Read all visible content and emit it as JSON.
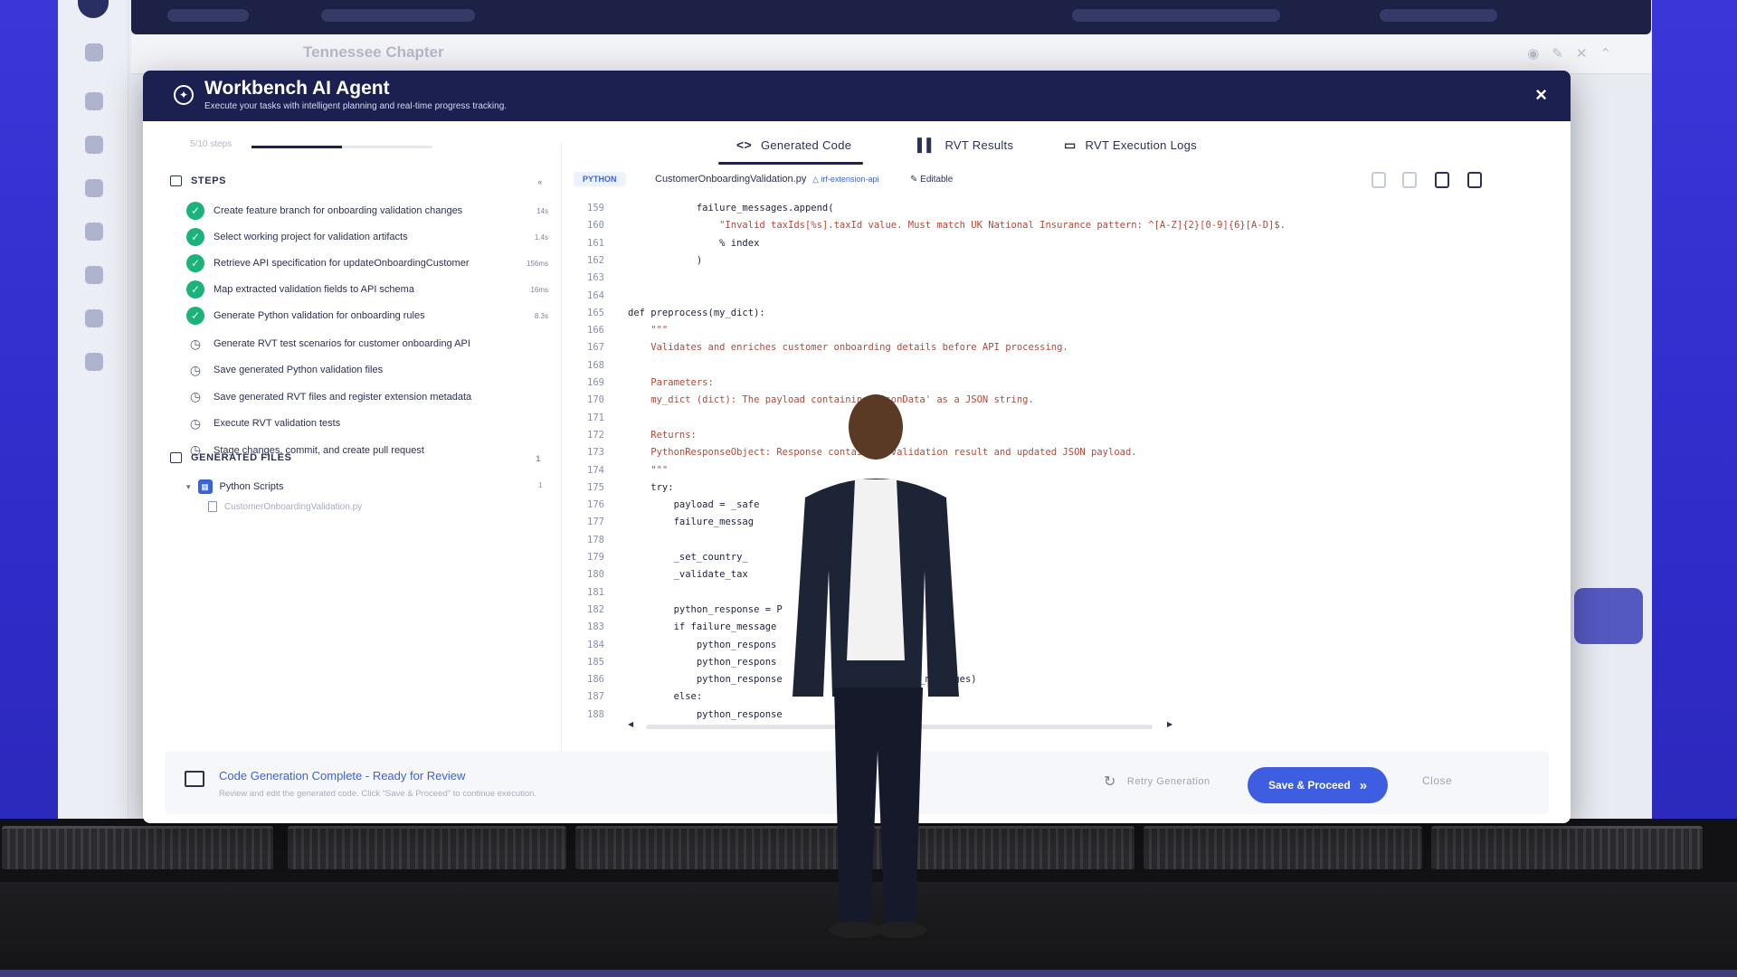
{
  "modal": {
    "title": "Workbench AI Agent",
    "subtitle": "Execute your tasks with intelligent planning and real-time progress tracking.",
    "close_glyph": "×"
  },
  "progress": {
    "text": "5/10 steps",
    "fraction": 0.5
  },
  "steps_section": {
    "label": "STEPS",
    "collapse_glyph": "«"
  },
  "steps": [
    {
      "label": "Create feature branch for onboarding validation changes",
      "status": "done",
      "duration": "14s"
    },
    {
      "label": "Select working project for validation artifacts",
      "status": "done",
      "duration": "1.4s"
    },
    {
      "label": "Retrieve API specification for updateOnboardingCustomer",
      "status": "done",
      "duration": "156ms"
    },
    {
      "label": "Map extracted validation fields to API schema",
      "status": "done",
      "duration": "16ms"
    },
    {
      "label": "Generate Python validation for onboarding rules",
      "status": "done",
      "duration": "8.3s"
    },
    {
      "label": "Generate RVT test scenarios for customer onboarding API",
      "status": "pending",
      "duration": ""
    },
    {
      "label": "Save generated Python validation files",
      "status": "pending",
      "duration": ""
    },
    {
      "label": "Save generated RVT files and register extension metadata",
      "status": "pending",
      "duration": ""
    },
    {
      "label": "Execute RVT validation tests",
      "status": "pending",
      "duration": ""
    },
    {
      "label": "Stage changes, commit, and create pull request",
      "status": "pending",
      "duration": ""
    }
  ],
  "generated_files": {
    "label": "GENERATED FILES",
    "count": "1",
    "folder": {
      "label": "Python Scripts",
      "count": "1"
    },
    "file": "CustomerOnboardingValidation.py"
  },
  "tabs": [
    {
      "icon": "<>",
      "label": "Generated Code",
      "active": true
    },
    {
      "icon": "▌▌",
      "label": "RVT Results",
      "active": false
    },
    {
      "icon": "▭",
      "label": "RVT Execution Logs",
      "active": false
    }
  ],
  "file_toolbar": {
    "language": "PYTHON",
    "file_name": "CustomerOnboardingValidation.py",
    "repo": "△ irf-extension-api",
    "editable": "✎ Editable"
  },
  "code": [
    {
      "ln": "159",
      "text": "            failure_messages.append("
    },
    {
      "ln": "160",
      "text": "                \"Invalid taxIds[%s].taxId value. Must match UK National Insurance pattern: ^[A-Z]{2}[0-9]{6}[A-D]$."
    },
    {
      "ln": "161",
      "text": "                % index"
    },
    {
      "ln": "162",
      "text": "            )"
    },
    {
      "ln": "163",
      "text": ""
    },
    {
      "ln": "164",
      "text": ""
    },
    {
      "ln": "165",
      "text": "def preprocess(my_dict):"
    },
    {
      "ln": "166",
      "text": "    \"\"\""
    },
    {
      "ln": "167",
      "text": "    Validates and enriches customer onboarding details before API processing."
    },
    {
      "ln": "168",
      "text": ""
    },
    {
      "ln": "169",
      "text": "    Parameters:"
    },
    {
      "ln": "170",
      "text": "    my_dict (dict): The payload containing 'jsonData' as a JSON string."
    },
    {
      "ln": "171",
      "text": ""
    },
    {
      "ln": "172",
      "text": "    Returns:"
    },
    {
      "ln": "173",
      "text": "    PythonResponseObject: Response containing validation result and updated JSON payload."
    },
    {
      "ln": "174",
      "text": "    \"\"\""
    },
    {
      "ln": "175",
      "text": "    try:"
    },
    {
      "ln": "176",
      "text": "        payload = _safe"
    },
    {
      "ln": "177",
      "text": "        failure_messag"
    },
    {
      "ln": "178",
      "text": ""
    },
    {
      "ln": "179",
      "text": "        _set_country_"
    },
    {
      "ln": "180",
      "text": "        _validate_tax                   messages)"
    },
    {
      "ln": "181",
      "text": ""
    },
    {
      "ln": "182",
      "text": "        python_response = P                    ()"
    },
    {
      "ln": "183",
      "text": "        if failure_message"
    },
    {
      "ln": "184",
      "text": "            python_respons"
    },
    {
      "ln": "185",
      "text": "            python_respons"
    },
    {
      "ln": "186",
      "text": "            python_response                (failure_messages)"
    },
    {
      "ln": "187",
      "text": "        else:"
    },
    {
      "ln": "188",
      "text": "            python_response"
    }
  ],
  "footer": {
    "title": "Code Generation Complete - Ready for Review",
    "subtitle": "Review and edit the generated code. Click \"Save & Proceed\" to continue execution.",
    "retry_label": "Retry Generation",
    "save_label": "Save & Proceed",
    "close_label": "Close"
  },
  "background_app": {
    "title": "Tennessee Chapter"
  },
  "colors": {
    "header_navy": "#1b2050",
    "accent_blue": "#3d5ee0",
    "success_green": "#1bb37a",
    "stage_blue": "#3a36d8"
  }
}
